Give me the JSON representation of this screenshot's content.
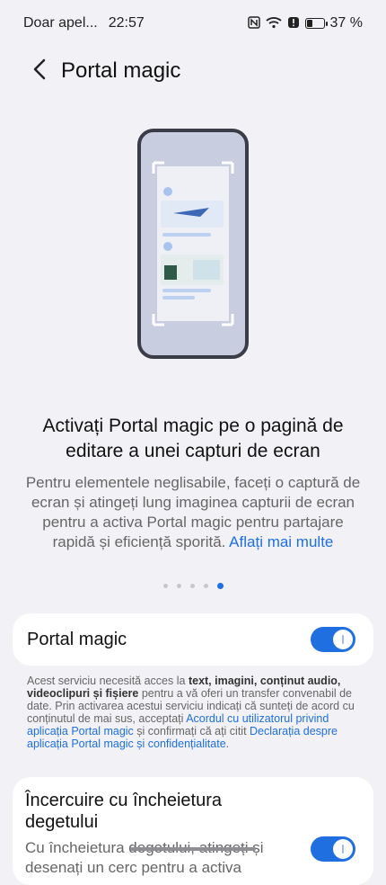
{
  "status_bar": {
    "carrier": "Doar apel...",
    "time": "22:57",
    "battery": "37 %",
    "icons": [
      "nfc-icon",
      "wifi-icon",
      "alert-icon",
      "battery-icon"
    ]
  },
  "header": {
    "back_icon": "back-arrow-icon",
    "title": "Portal magic"
  },
  "intro": {
    "headline": "Activați Portal magic pe o pagină de editare a unei capturi de ecran",
    "description": "Pentru elementele neglisabile, faceți o captură de ecran și atingeți lung imaginea capturii de ecran pentru a activa Portal magic pentru partajare rapidă și eficiență sporită. ",
    "learn_more": "Aflați mai multe"
  },
  "pager": {
    "count": 5,
    "active_index": 4
  },
  "portal_setting": {
    "label": "Portal magic",
    "enabled": true
  },
  "note": {
    "t1": "Acest serviciu necesită acces la ",
    "b1": "text, imagini, conținut audio, videoclipuri și fișiere",
    "t2": " pentru a vă oferi un transfer convenabil de date. Prin activarea acestui serviciu indicați că sunteți de acord cu conținutul de mai sus, acceptați ",
    "link1": "Acordul cu utilizatorul privind aplicația Portal magic",
    "t3": " și confirmați că ați citit ",
    "link2": "Declarația despre aplicația Portal magic și confidențialitate",
    "t4": "."
  },
  "knuckle_setting": {
    "title": "Încercuire cu încheietura degetului",
    "description": "Cu încheietura degetului, atingeți și desenați un cerc pentru a activa",
    "enabled": true
  },
  "colors": {
    "accent": "#1f6fe0",
    "background": "#f2f2f6",
    "card": "#ffffff"
  }
}
